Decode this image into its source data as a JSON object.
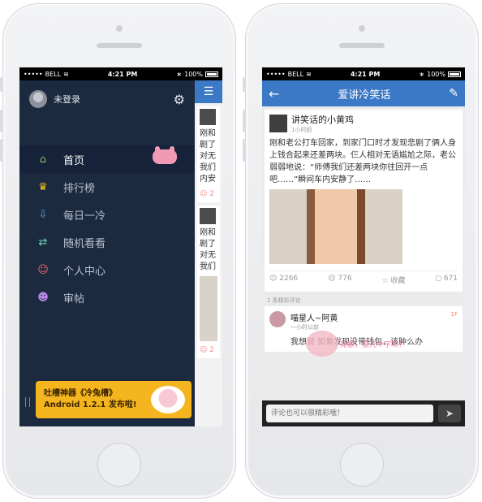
{
  "status_bar": {
    "carrier": "BELL",
    "time": "4:21 PM",
    "battery": "100%"
  },
  "drawer": {
    "user_name": "未登录",
    "menu": [
      {
        "label": "首页",
        "icon": "home-icon"
      },
      {
        "label": "排行榜",
        "icon": "trophy-icon"
      },
      {
        "label": "每日一冷",
        "icon": "download-icon"
      },
      {
        "label": "随机看看",
        "icon": "shuffle-icon"
      },
      {
        "label": "个人中心",
        "icon": "user-icon"
      },
      {
        "label": "审帖",
        "icon": "review-icon"
      }
    ],
    "banner_line1": "吐槽神器《冷兔槽》",
    "banner_line2": "Android 1.2.1 发布啦!"
  },
  "peek": {
    "post1_text": "刚和剧了对无我们内安",
    "post1_count": "2",
    "post2_text": "刚和剧了对无我们",
    "post2_count": "2"
  },
  "app": {
    "title": "爱讲冷笑话",
    "post": {
      "author": "讲笑话的小黄鸡",
      "time": "1小时前",
      "text": "刚和老公打车回家，到家门口时才发现悲剧了俩人身上钱合起来还差两块。仨人相对无语尴尬之际，老公弱弱地说：“师傅我们还差两块你往回开一点吧……”瞬间车内安静了……",
      "likes": "2266",
      "dislikes": "776",
      "favorite": "收藏",
      "comments": "671"
    },
    "comments_header": "1 条精彩评论",
    "comment": {
      "name": "喵星人~阿黄",
      "time": "一小时以前",
      "text": "我想说 如果发现没带钱包，该肿么办",
      "floor": "1F"
    },
    "empty_text": "竟家，留几个字呗！",
    "input_placeholder": "评论也可以很精彩哦！"
  }
}
